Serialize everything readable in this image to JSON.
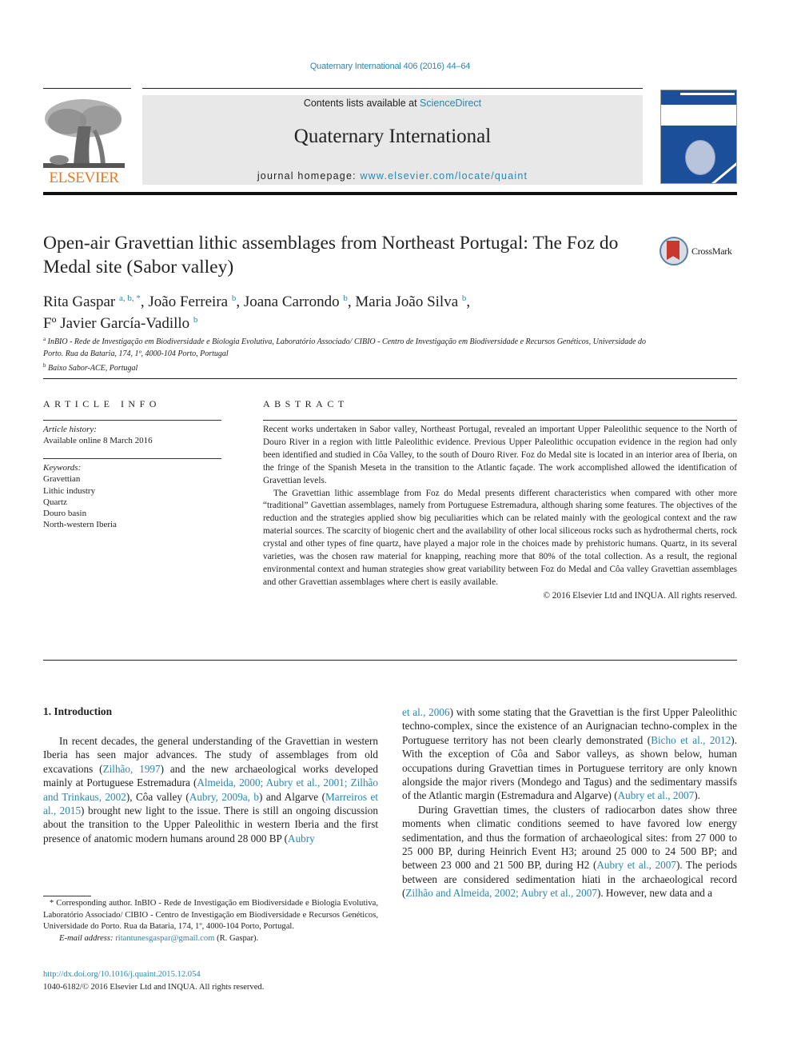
{
  "header": {
    "journal_ref": "Quaternary International 406 (2016) 44–64",
    "contents_prefix": "Contents lists available at ",
    "contents_link": "ScienceDirect",
    "journal_title": "Quaternary International",
    "homepage_prefix": "journal homepage: ",
    "homepage_link": "www.elsevier.com/locate/quaint",
    "publisher_logo": "ELSEVIER",
    "crossmark_label": "CrossMark"
  },
  "article": {
    "title": "Open-air Gravettian lithic assemblages from Northeast Portugal: The Foz do Medal site (Sabor valley)",
    "authors": [
      {
        "name": "Rita Gaspar",
        "aff": "a, b, *",
        "sep": ", "
      },
      {
        "name": "João Ferreira",
        "aff": "b",
        "sep": ", "
      },
      {
        "name": "Joana Carrondo",
        "aff": "b",
        "sep": ", "
      },
      {
        "name": "Maria João Silva",
        "aff": "b",
        "sep": ","
      },
      {
        "name": "Fº Javier García-Vadillo",
        "aff": "b",
        "sep": ""
      }
    ],
    "affiliations": [
      {
        "mark": "a",
        "text": "InBIO - Rede de Investigação em Biodiversidade e Biologia Evolutiva, Laboratório Associado/ CIBIO - Centro de Investigação em Biodiversidade e Recursos Genéticos, Universidade do Porto. Rua da Bataria, 174, 1º, 4000-104 Porto, Portugal"
      },
      {
        "mark": "b",
        "text": "Baixo Sabor-ACE, Portugal"
      }
    ]
  },
  "article_info": {
    "heading": "ARTICLE INFO",
    "history_label": "Article history:",
    "history_value": "Available online 8 March 2016",
    "keywords_label": "Keywords:",
    "keywords": [
      "Gravettian",
      "Lithic industry",
      "Quartz",
      "Douro basin",
      "North-western Iberia"
    ]
  },
  "abstract": {
    "heading": "ABSTRACT",
    "paragraphs": [
      "Recent works undertaken in Sabor valley, Northeast Portugal, revealed an important Upper Paleolithic sequence to the North of Douro River in a region with little Paleolithic evidence. Previous Upper Paleolithic occupation evidence in the region had only been identified and studied in Côa Valley, to the south of Douro River. Foz do Medal site is located in an interior area of Iberia, on the fringe of the Spanish Meseta in the transition to the Atlantic façade. The work accomplished allowed the identification of Gravettian levels.",
      "The Gravettian lithic assemblage from Foz do Medal presents different characteristics when compared with other more “traditional” Gavettian assemblages, namely from Portuguese Estremadura, although sharing some features. The objectives of the reduction and the strategies applied show big peculiarities which can be related mainly with the geological context and the raw material sources. The scarcity of biogenic chert and the availability of other local siliceous rocks such as hydrothermal cherts, rock crystal and other types of fine quartz, have played a major role in the choices made by prehistoric humans. Quartz, in its several varieties, was the chosen raw material for knapping, reaching more that 80% of the total collection. As a result, the regional environmental context and human strategies show great variability between Foz do Medal and Côa valley Gravettian assemblages and other Gravettian assemblages where chert is easily available."
    ],
    "copyright": "© 2016 Elsevier Ltd and INQUA. All rights reserved."
  },
  "body": {
    "section_heading": "1.  Introduction",
    "left_paragraph": [
      {
        "t": "In recent decades, the general understanding of the Gravettian in western Iberia has seen major advances. The study of assemblages from old excavations ("
      },
      {
        "l": "Zilhão, 1997"
      },
      {
        "t": ") and the new archaeological works developed mainly at Portuguese Estremadura ("
      },
      {
        "l": "Almeida, 2000; Aubry et al., 2001; Zilhão and Trinkaus, 2002"
      },
      {
        "t": "), Côa valley ("
      },
      {
        "l": "Aubry, 2009a, b"
      },
      {
        "t": ") and Algarve ("
      },
      {
        "l": "Marreiros et al., 2015"
      },
      {
        "t": ") brought new light to the issue. There is still an ongoing discussion about the transition to the Upper Paleolithic in western Iberia and the first presence of anatomic modern humans around 28 000 BP ("
      },
      {
        "l": "Aubry"
      }
    ],
    "right_paragraph_1": [
      {
        "l": "et al., 2006"
      },
      {
        "t": ") with some stating that the Gravettian is the first Upper Paleolithic techno-complex, since the existence of an Aurignacian techno-complex in the Portuguese territory has not been clearly demonstrated ("
      },
      {
        "l": "Bicho et al., 2012"
      },
      {
        "t": "). With the exception of Côa and Sabor valleys, as shown below, human occupations during Gravettian times in Portuguese territory are only known alongside the major rivers (Mondego and Tagus) and the sedimentary massifs of the Atlantic margin (Estremadura and Algarve) ("
      },
      {
        "l": "Aubry et al., 2007"
      },
      {
        "t": ")."
      }
    ],
    "right_paragraph_2": [
      {
        "t": "During Gravettian times, the clusters of radiocarbon dates show three moments when climatic conditions seemed to have favored low energy sedimentation, and thus the formation of archaeological sites: from 27 000 to 25 000 BP, during Heinrich Event H3; around 25 000 to 24 500 BP; and between 23 000 and 21 500 BP, during H2 ("
      },
      {
        "l": "Aubry et al., 2007"
      },
      {
        "t": "). The periods between are considered sedimentation hiati in the archaeological record ("
      },
      {
        "l": "Zilhão and Almeida, 2002; Aubry et al., 2007"
      },
      {
        "t": "). However, new data and a"
      }
    ]
  },
  "footnote": {
    "star_text": "* Corresponding author. InBIO - Rede de Investigação em Biodiversidade e Biologia Evolutiva, Laboratório Associado/ CIBIO - Centro de Investigação em Biodiversidade e Recursos Genéticos, Universidade do Porto. Rua da Bataria, 174, 1º, 4000-104 Porto, Portugal.",
    "email_label": "E-mail address:",
    "email": "ritantunesgaspar@gmail.com",
    "email_suffix": " (R. Gaspar).",
    "doi": "http://dx.doi.org/10.1016/j.quaint.2015.12.054",
    "issn": "1040-6182/© 2016 Elsevier Ltd and INQUA. All rights reserved."
  }
}
